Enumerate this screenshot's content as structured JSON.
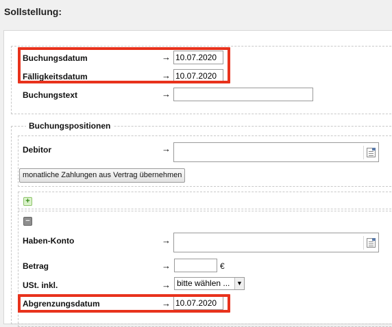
{
  "title": "Sollstellung:",
  "arrow": "→",
  "header_fields": {
    "buchungsdatum": {
      "label": "Buchungsdatum",
      "value": "10.07.2020"
    },
    "faelligkeitsdatum": {
      "label": "Fälligkeitsdatum",
      "value": "10.07.2020"
    },
    "buchungstext": {
      "label": "Buchungstext",
      "value": ""
    }
  },
  "positions": {
    "legend": "Buchungspositionen",
    "debitor": {
      "label": "Debitor",
      "value": ""
    },
    "apply_button": "monatliche Zahlungen aus Vertrag übernehmen",
    "add_symbol": "+",
    "remove_symbol": "−",
    "haben_konto": {
      "label": "Haben-Konto",
      "value": ""
    },
    "betrag": {
      "label": "Betrag",
      "value": "",
      "unit": "€"
    },
    "ust": {
      "label": "USt. inkl.",
      "selected": "bitte wählen ..."
    },
    "abgrenzungsdatum": {
      "label": "Abgrenzungsdatum",
      "value": "10.07.2020"
    }
  },
  "colors": {
    "highlight": "#e8321c"
  }
}
